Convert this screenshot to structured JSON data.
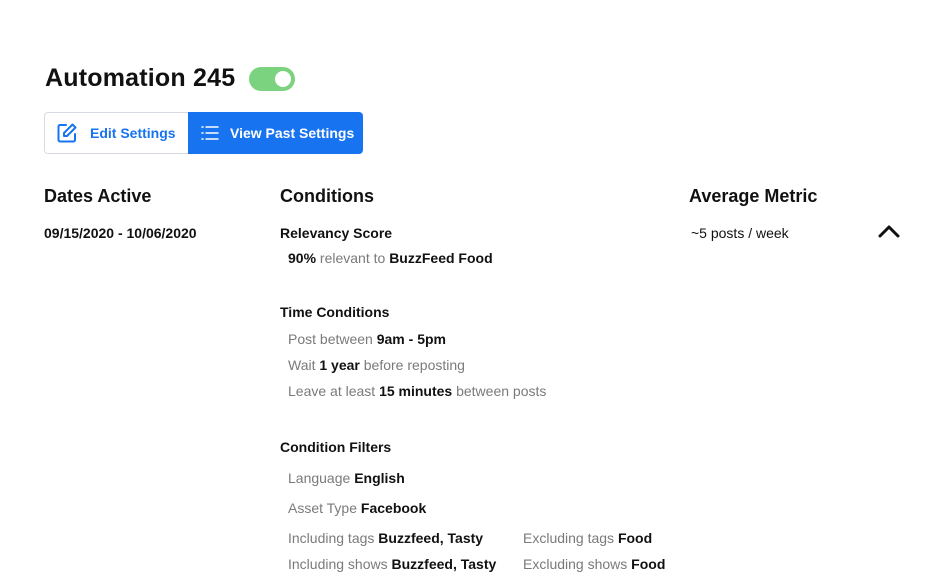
{
  "header": {
    "title": "Automation 245",
    "toggle_on": true,
    "toggle_color": "#7bd37f"
  },
  "toolbar": {
    "edit_label": "Edit Settings",
    "view_label": "View Past Settings",
    "edit_icon": "edit-icon",
    "view_icon": "list-icon",
    "accent_color": "#1873f0"
  },
  "dates": {
    "heading": "Dates Active",
    "range": "09/15/2020 - 10/06/2020"
  },
  "conditions": {
    "heading": "Conditions",
    "relevancy": {
      "heading": "Relevancy Score",
      "value": "90%",
      "text": "relevant to",
      "target": "BuzzFeed Food"
    },
    "time": {
      "heading": "Time Conditions",
      "post_between_label": "Post between",
      "post_between_value": "9am - 5pm",
      "wait_label": "Wait",
      "wait_value": "1 year",
      "wait_suffix": "before reposting",
      "leave_label": "Leave at least",
      "leave_value": "15 minutes",
      "leave_suffix": "between posts"
    },
    "filters": {
      "heading": "Condition Filters",
      "language_label": "Language",
      "language_value": "English",
      "asset_type_label": "Asset Type",
      "asset_type_value": "Facebook",
      "including_tags_label": "Including tags",
      "including_tags_value": "Buzzfeed, Tasty",
      "excluding_tags_label": "Excluding tags",
      "excluding_tags_value": "Food",
      "including_shows_label": "Including shows",
      "including_shows_value": "Buzzfeed, Tasty",
      "excluding_shows_label": "Excluding shows",
      "excluding_shows_value": "Food"
    }
  },
  "metric": {
    "heading": "Average Metric",
    "value": "~5 posts / week",
    "collapse_icon": "chevron-up-icon"
  }
}
